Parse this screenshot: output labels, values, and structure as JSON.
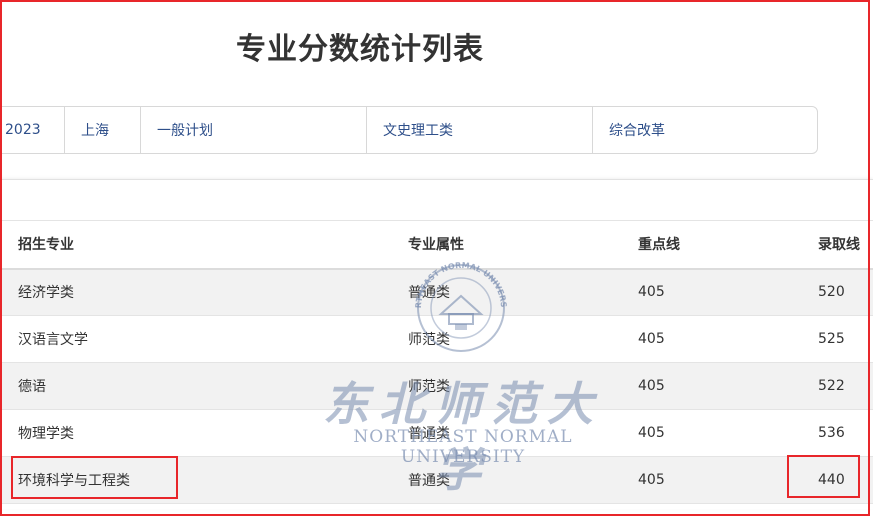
{
  "page": {
    "title": "专业分数统计列表"
  },
  "filters": {
    "year": "2023",
    "region": "上海",
    "plan": "一般计划",
    "category": "文史理工类",
    "reform": "综合改革"
  },
  "table": {
    "headers": {
      "major": "招生专业",
      "attribute": "专业属性",
      "key_line": "重点线",
      "admission_line": "录取线"
    },
    "rows": [
      {
        "major": "经济学类",
        "attribute": "普通类",
        "key_line": "405",
        "admission_line": "520"
      },
      {
        "major": "汉语言文学",
        "attribute": "师范类",
        "key_line": "405",
        "admission_line": "525"
      },
      {
        "major": "德语",
        "attribute": "师范类",
        "key_line": "405",
        "admission_line": "522"
      },
      {
        "major": "物理学类",
        "attribute": "普通类",
        "key_line": "405",
        "admission_line": "536"
      },
      {
        "major": "环境科学与工程类",
        "attribute": "普通类",
        "key_line": "405",
        "admission_line": "440"
      }
    ]
  },
  "watermark": {
    "seal_text": "NORTHEAST NORMAL UNIVERSITY",
    "name_cn": "东北师范大学",
    "name_en": "NORTHEAST NORMAL UNIVERSITY"
  },
  "colors": {
    "highlight": "#e8262a",
    "filter_text": "#2e4f8a",
    "stripe": "#f2f2f2"
  }
}
